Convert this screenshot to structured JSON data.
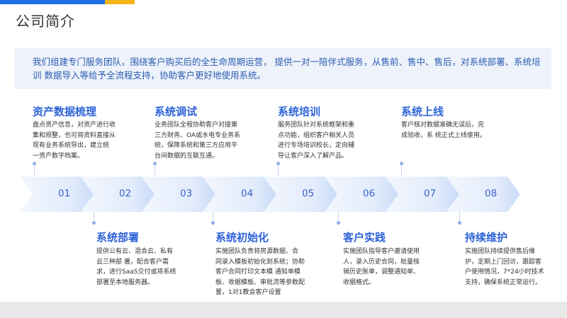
{
  "page": {
    "title": "公司简介"
  },
  "intro": "我们组建专门服务团队，围绕客户购买后的全生命周期运营， 提供一对一陪伴式服务，从售前、售中、售后，对系统部署、系统培训 数据导入等给予全流程支持，协助客户更好地使用系统。",
  "steps": [
    "01",
    "02",
    "03",
    "04",
    "05",
    "06",
    "07",
    "08"
  ],
  "stages": [
    {
      "title": "资产数据梳理",
      "desc": [
        "盘点资产信息，对资产进行收",
        "集和规整，也可将资料直接从",
        "现有业务系统导出，建立统",
        "一资产数字档案。"
      ]
    },
    {
      "title": "系统部署",
      "desc": [
        "提供公有云、混合云、私有",
        "云三种部 署，配合客户需",
        "求，进行SaaS交付或将系统",
        "部署至本地服务器。"
      ]
    },
    {
      "title": "系统调试",
      "desc": [
        "业务团队全程协助客户对接第",
        "三方财务、OA或水电专业务系",
        "统，保障系统和第三方应用平",
        "台间数据的互联互通。"
      ]
    },
    {
      "title": "系统初始化",
      "desc": [
        " 实施团队负责将房源数据、合",
        "同录入模板初始化到系统；协助",
        "客户合同打印文本模 通知单模",
        "板、收据模板、审批流等参数配",
        "置，1对1教会客户设置"
      ]
    },
    {
      "title": "系统培训",
      "desc": [
        "服务团队针对系统框架和重",
        "点功能，组织客户相关人员",
        "进行专场培训校长，定向辅",
        "导让客户深入了解产品。"
      ]
    },
    {
      "title": "客户实践",
      "desc": [
        "实施团队指导客户邀请使用",
        "人，录入历史合同，批量核",
        "销历史账单，调整通知单、",
        "收据格式。"
      ]
    },
    {
      "title": "系统上线",
      "desc": [
        "客户核对数据准确无误后，完",
        "成验收，系 统正式上线使用。"
      ]
    },
    {
      "title": "持续维护",
      "desc": [
        "实施团队持续提供售后维",
        "护，定期上门回访，跟踪客",
        "户使用情况，7*24小时技术",
        "支持，确保系统正常运行。"
      ]
    }
  ],
  "colors": {
    "primary": "#2d63d8",
    "accent": "#f5b417",
    "band_light": "#eaf1fd",
    "band_dark": "#c8daf7"
  }
}
